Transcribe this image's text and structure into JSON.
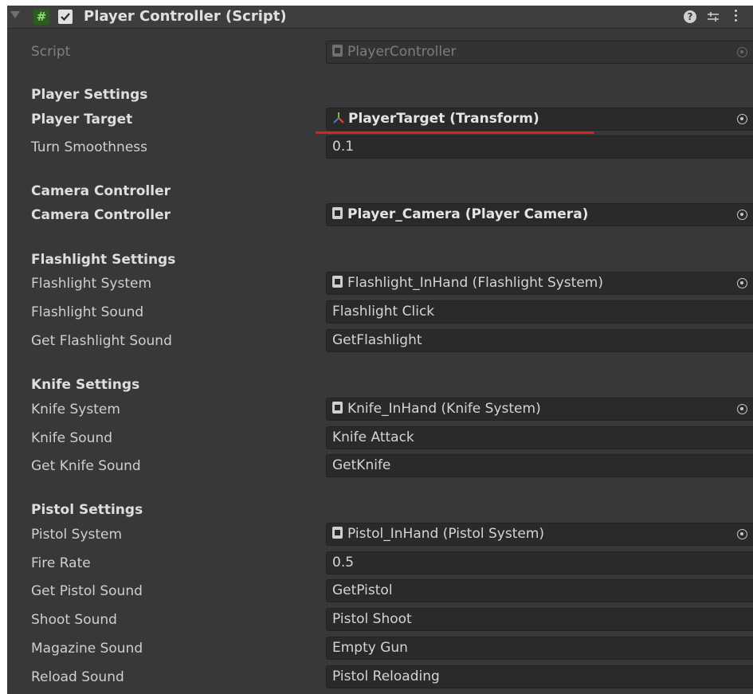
{
  "component": {
    "title": "Player Controller (Script)",
    "enabled": true
  },
  "rows": {
    "script": {
      "label": "Script",
      "value": "PlayerController"
    },
    "player_settings_heading": "Player Settings",
    "player_target": {
      "label": "Player Target",
      "value": "PlayerTarget (Transform)"
    },
    "turn_smoothness": {
      "label": "Turn Smoothness",
      "value": "0.1"
    },
    "camera_heading": "Camera Controller",
    "camera_controller": {
      "label": "Camera Controller",
      "value": "Player_Camera (Player Camera)"
    },
    "flashlight_heading": "Flashlight Settings",
    "flashlight_system": {
      "label": "Flashlight System",
      "value": "Flashlight_InHand (Flashlight System)"
    },
    "flashlight_sound": {
      "label": "Flashlight Sound",
      "value": "Flashlight Click"
    },
    "get_flashlight_sound": {
      "label": "Get Flashlight Sound",
      "value": "GetFlashlight"
    },
    "knife_heading": "Knife Settings",
    "knife_system": {
      "label": "Knife System",
      "value": "Knife_InHand (Knife System)"
    },
    "knife_sound": {
      "label": "Knife Sound",
      "value": "Knife Attack"
    },
    "get_knife_sound": {
      "label": "Get Knife Sound",
      "value": "GetKnife"
    },
    "pistol_heading": "Pistol Settings",
    "pistol_system": {
      "label": "Pistol System",
      "value": "Pistol_InHand (Pistol System)"
    },
    "fire_rate": {
      "label": "Fire Rate",
      "value": "0.5"
    },
    "get_pistol_sound": {
      "label": "Get Pistol Sound",
      "value": "GetPistol"
    },
    "shoot_sound": {
      "label": "Shoot Sound",
      "value": "Pistol Shoot"
    },
    "magazine_sound": {
      "label": "Magazine Sound",
      "value": "Empty Gun"
    },
    "reload_sound": {
      "label": "Reload Sound",
      "value": "Pistol Reloading"
    }
  },
  "colors": {
    "panel_background": "#383838",
    "field_background": "#2a2a2a",
    "highlight_underline": "#e21d1d",
    "script_icon_green": "#2c5b1f"
  }
}
